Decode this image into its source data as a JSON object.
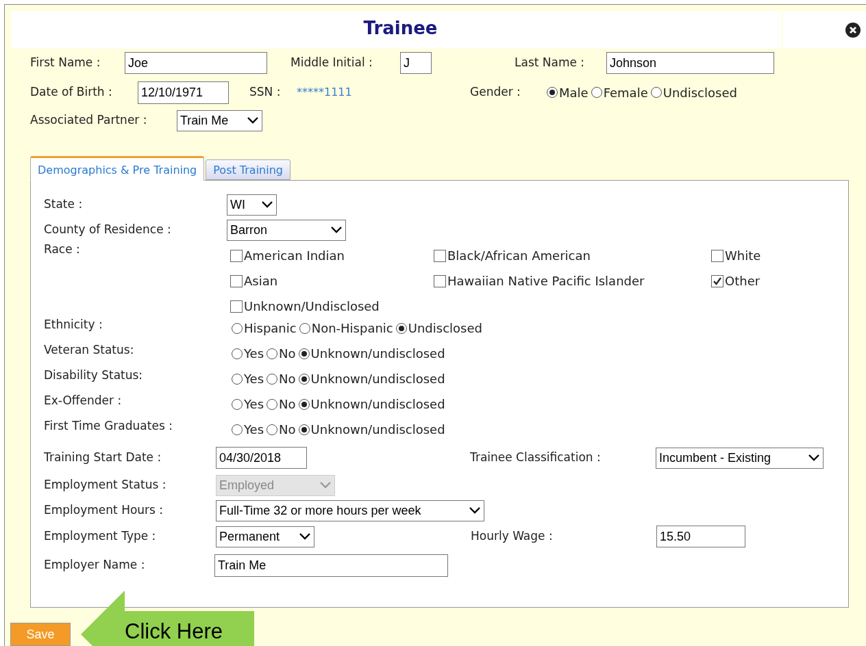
{
  "title": "Trainee",
  "first_name": {
    "label": "First Name :",
    "value": "Joe"
  },
  "middle_initial": {
    "label": "Middle Initial :",
    "value": "J"
  },
  "last_name": {
    "label": "Last Name :",
    "value": "Johnson"
  },
  "date_of_birth": {
    "label": "Date of Birth :",
    "value": "12/10/1971"
  },
  "ssn": {
    "label": "SSN :",
    "value": "*****1111"
  },
  "gender": {
    "label": "Gender :",
    "options": [
      {
        "label": "Male",
        "selected": true
      },
      {
        "label": "Female",
        "selected": false
      },
      {
        "label": "Undisclosed",
        "selected": false
      }
    ]
  },
  "associated_partner": {
    "label": "Associated Partner :",
    "value": "Train Me"
  },
  "tabs": [
    {
      "label": "Demographics & Pre Training",
      "selected": true
    },
    {
      "label": "Post Training",
      "selected": false
    }
  ],
  "state": {
    "label": "State :",
    "value": "WI"
  },
  "county": {
    "label": "County of Residence :",
    "value": "Barron"
  },
  "race": {
    "label": "Race :",
    "options": [
      {
        "label": "American Indian",
        "checked": false
      },
      {
        "label": "Black/African American",
        "checked": false
      },
      {
        "label": "White",
        "checked": false
      },
      {
        "label": "Asian",
        "checked": false
      },
      {
        "label": "Hawaiian Native Pacific Islander",
        "checked": false
      },
      {
        "label": "Other",
        "checked": true
      },
      {
        "label": "Unknown/Undisclosed",
        "checked": false
      }
    ]
  },
  "radio_rows": [
    {
      "label": "Ethnicity :",
      "options": [
        {
          "label": "Hispanic",
          "selected": false
        },
        {
          "label": "Non-Hispanic",
          "selected": false
        },
        {
          "label": "Undisclosed",
          "selected": true
        }
      ]
    },
    {
      "label": "Veteran Status:",
      "options": [
        {
          "label": "Yes",
          "selected": false
        },
        {
          "label": "No",
          "selected": false
        },
        {
          "label": "Unknown/undisclosed",
          "selected": true
        }
      ]
    },
    {
      "label": "Disability Status:",
      "options": [
        {
          "label": "Yes",
          "selected": false
        },
        {
          "label": "No",
          "selected": false
        },
        {
          "label": "Unknown/undisclosed",
          "selected": true
        }
      ]
    },
    {
      "label": "Ex-Offender :",
      "options": [
        {
          "label": "Yes",
          "selected": false
        },
        {
          "label": "No",
          "selected": false
        },
        {
          "label": "Unknown/undisclosed",
          "selected": true
        }
      ]
    },
    {
      "label": "First Time Graduates :",
      "options": [
        {
          "label": "Yes",
          "selected": false
        },
        {
          "label": "No",
          "selected": false
        },
        {
          "label": "Unknown/undisclosed",
          "selected": true
        }
      ]
    }
  ],
  "training_start_date": {
    "label": "Training Start Date :",
    "value": "04/30/2018"
  },
  "trainee_classification": {
    "label": "Trainee Classification :",
    "value": "Incumbent - Existing"
  },
  "employment_status": {
    "label": "Employment Status :",
    "value": "Employed",
    "disabled": true
  },
  "employment_hours": {
    "label": "Employment Hours :",
    "value": "Full-Time 32 or more hours per week"
  },
  "employment_type": {
    "label": "Employment Type :",
    "value": "Permanent"
  },
  "hourly_wage": {
    "label": "Hourly Wage :",
    "value": "15.50"
  },
  "employer_name": {
    "label": "Employer Name :",
    "value": "Train Me"
  },
  "save_button": "Save",
  "callout": "Click Here"
}
